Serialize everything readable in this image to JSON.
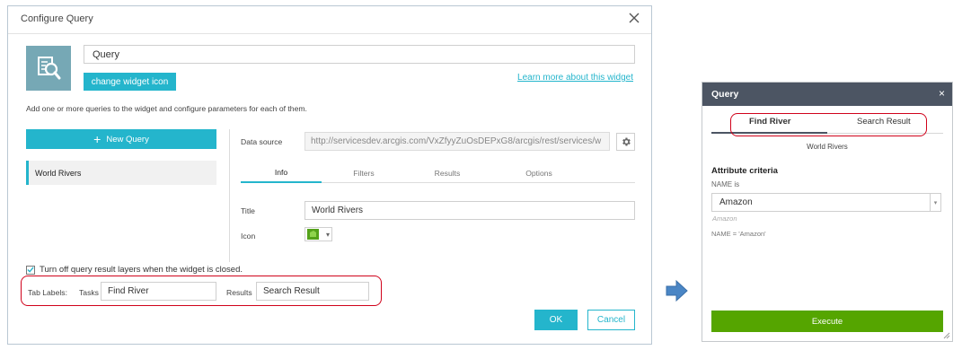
{
  "dialog": {
    "title": "Configure Query",
    "widget_name": "Query",
    "change_icon_label": "change widget icon",
    "learn_more_label": "Learn more about this widget",
    "description": "Add one or more queries to the widget and configure parameters for each of them.",
    "new_query_label": "New Query",
    "queries": [
      "World Rivers"
    ],
    "data_source_label": "Data source",
    "data_source_value": "http://servicesdev.arcgis.com/VxZfyyZuOsDEPxG8/arcgis/rest/services/w",
    "tabs": [
      "Info",
      "Filters",
      "Results",
      "Options"
    ],
    "active_tab": "Info",
    "title_label": "Title",
    "title_value": "World Rivers",
    "icon_label": "Icon",
    "turn_off_label": "Turn off query result layers when the widget is closed.",
    "turn_off_checked": true,
    "tab_labels_label": "Tab Labels:",
    "tasks_label": "Tasks",
    "tasks_value": "Find River",
    "results_label": "Results",
    "results_value": "Search Result",
    "ok_label": "OK",
    "cancel_label": "Cancel"
  },
  "panel": {
    "title": "Query",
    "close_icon": "×",
    "tabs": [
      "Find River",
      "Search Result"
    ],
    "active_tab": "Find River",
    "layer_name": "World Rivers",
    "criteria_heading": "Attribute criteria",
    "field_label": "NAME is",
    "field_value": "Amazon",
    "field_hint": "Amazon",
    "expression": "NAME = 'Amazon'",
    "execute_label": "Execute"
  },
  "colors": {
    "accent": "#24b5cc",
    "panel_header": "#4c5563",
    "execute": "#55a500",
    "highlight": "#d0021b",
    "arrow": "#4a86c5"
  }
}
